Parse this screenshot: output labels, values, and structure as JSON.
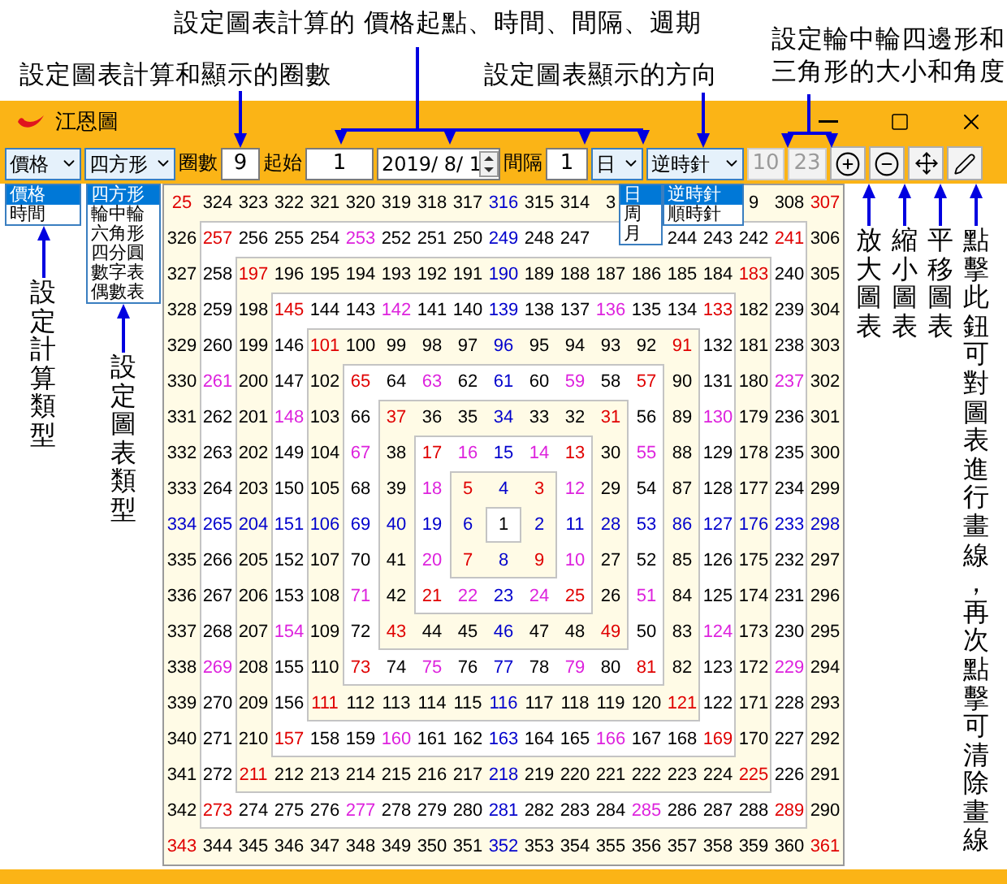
{
  "callouts": [
    {
      "lines": [
        "設定圖表計算的 價格起點、時間、間隔、週期"
      ]
    },
    {
      "lines": [
        "設定圖表計算和顯示的圈數"
      ]
    },
    {
      "lines": [
        "設定圖表顯示的方向"
      ]
    },
    {
      "lines": [
        "設定輪中輪四邊形和",
        "三角形的大小和角度"
      ]
    }
  ],
  "window": {
    "title": "江恩圖"
  },
  "toolbar": {
    "calc_type": {
      "value": "價格",
      "options": [
        {
          "label": "價格",
          "selected": true
        },
        {
          "label": "時間",
          "selected": false
        }
      ]
    },
    "chart_type": {
      "value": "四方形",
      "options": [
        {
          "label": "四方形",
          "selected": true
        },
        {
          "label": "輪中輪",
          "selected": false
        },
        {
          "label": "六角形",
          "selected": false
        },
        {
          "label": "四分圓",
          "selected": false
        },
        {
          "label": "數字表",
          "selected": false
        },
        {
          "label": "偶數表",
          "selected": false
        }
      ]
    },
    "rings_label": "圈數",
    "rings": "9",
    "start_label": "起始",
    "start": "1",
    "date": "2019/ 8/ 1",
    "interval_label": "間隔",
    "interval": "1",
    "period": {
      "value": "日",
      "options": [
        {
          "label": "日",
          "selected": true
        },
        {
          "label": "周",
          "selected": false
        },
        {
          "label": "月",
          "selected": false
        }
      ]
    },
    "direction": {
      "value": "逆時針",
      "options": [
        {
          "label": "逆時針",
          "selected": true
        },
        {
          "label": "順時針",
          "selected": false
        }
      ]
    },
    "size": {
      "value": "10",
      "disabled": true
    },
    "angle": {
      "value": "23",
      "disabled": true
    }
  },
  "side_notes_left": [
    "設定計算類型",
    "設定圖表類型"
  ],
  "side_notes_right": [
    "放大圖表",
    "縮小圖表",
    "平移圖表",
    "點擊此鈕可對圖表進行畫線，再次點擊可清除畫線"
  ],
  "grid": {
    "rows": [
      [
        {
          "text": "25",
          "color": "#e00000"
        },
        {
          "text": "324"
        },
        {
          "text": "323"
        },
        {
          "text": "322"
        },
        {
          "text": "321"
        },
        {
          "text": "320"
        },
        {
          "text": "319"
        },
        {
          "text": "318"
        },
        {
          "text": "317"
        },
        {
          "text": "316",
          "color": "#0000cc"
        },
        {
          "text": "315"
        },
        {
          "text": "314"
        },
        {
          "text": "3"
        },
        null,
        null,
        null,
        {
          "text": "9"
        },
        {
          "text": "308"
        },
        {
          "text": "307",
          "color": "#e00000"
        }
      ],
      [
        {
          "text": "326"
        },
        {
          "text": "257",
          "color": "#e00000"
        },
        {
          "text": "256"
        },
        {
          "text": "255"
        },
        {
          "text": "254"
        },
        {
          "text": "253",
          "color": "#dd22dd"
        },
        {
          "text": "252"
        },
        {
          "text": "251"
        },
        {
          "text": "250"
        },
        {
          "text": "249",
          "color": "#0000cc"
        },
        {
          "text": "248"
        },
        {
          "text": "247"
        },
        null,
        null,
        {
          "text": "244"
        },
        {
          "text": "243"
        },
        {
          "text": "242"
        },
        {
          "text": "241",
          "color": "#e00000"
        },
        {
          "text": "306"
        }
      ],
      [
        {
          "text": "327"
        },
        {
          "text": "258"
        },
        {
          "text": "197",
          "color": "#e00000"
        },
        {
          "text": "196"
        },
        {
          "text": "195"
        },
        {
          "text": "194"
        },
        {
          "text": "193"
        },
        {
          "text": "192"
        },
        {
          "text": "191"
        },
        {
          "text": "190",
          "color": "#0000cc"
        },
        {
          "text": "189"
        },
        {
          "text": "188"
        },
        {
          "text": "187"
        },
        {
          "text": "186"
        },
        {
          "text": "185"
        },
        {
          "text": "184"
        },
        {
          "text": "183",
          "color": "#e00000"
        },
        {
          "text": "240"
        },
        {
          "text": "305"
        }
      ],
      [
        {
          "text": "328"
        },
        {
          "text": "259"
        },
        {
          "text": "198"
        },
        {
          "text": "145",
          "color": "#e00000"
        },
        {
          "text": "144"
        },
        {
          "text": "143"
        },
        {
          "text": "142",
          "color": "#dd22dd"
        },
        {
          "text": "141"
        },
        {
          "text": "140"
        },
        {
          "text": "139",
          "color": "#0000cc"
        },
        {
          "text": "138"
        },
        {
          "text": "137"
        },
        {
          "text": "136",
          "color": "#dd22dd"
        },
        {
          "text": "135"
        },
        {
          "text": "134"
        },
        {
          "text": "133",
          "color": "#e00000"
        },
        {
          "text": "182"
        },
        {
          "text": "239"
        },
        {
          "text": "304"
        }
      ],
      [
        {
          "text": "329"
        },
        {
          "text": "260"
        },
        {
          "text": "199"
        },
        {
          "text": "146"
        },
        {
          "text": "101",
          "color": "#e00000"
        },
        {
          "text": "100"
        },
        {
          "text": "99"
        },
        {
          "text": "98"
        },
        {
          "text": "97"
        },
        {
          "text": "96",
          "color": "#0000cc"
        },
        {
          "text": "95"
        },
        {
          "text": "94"
        },
        {
          "text": "93"
        },
        {
          "text": "92"
        },
        {
          "text": "91",
          "color": "#e00000"
        },
        {
          "text": "132"
        },
        {
          "text": "181"
        },
        {
          "text": "238"
        },
        {
          "text": "303"
        }
      ],
      [
        {
          "text": "330"
        },
        {
          "text": "261",
          "color": "#dd22dd"
        },
        {
          "text": "200"
        },
        {
          "text": "147"
        },
        {
          "text": "102"
        },
        {
          "text": "65",
          "color": "#e00000"
        },
        {
          "text": "64"
        },
        {
          "text": "63",
          "color": "#dd22dd"
        },
        {
          "text": "62"
        },
        {
          "text": "61",
          "color": "#0000cc"
        },
        {
          "text": "60"
        },
        {
          "text": "59",
          "color": "#dd22dd"
        },
        {
          "text": "58"
        },
        {
          "text": "57",
          "color": "#e00000"
        },
        {
          "text": "90"
        },
        {
          "text": "131"
        },
        {
          "text": "180"
        },
        {
          "text": "237",
          "color": "#dd22dd"
        },
        {
          "text": "302"
        }
      ],
      [
        {
          "text": "331"
        },
        {
          "text": "262"
        },
        {
          "text": "201"
        },
        {
          "text": "148",
          "color": "#dd22dd"
        },
        {
          "text": "103"
        },
        {
          "text": "66"
        },
        {
          "text": "37",
          "color": "#e00000"
        },
        {
          "text": "36"
        },
        {
          "text": "35"
        },
        {
          "text": "34",
          "color": "#0000cc"
        },
        {
          "text": "33"
        },
        {
          "text": "32"
        },
        {
          "text": "31",
          "color": "#e00000"
        },
        {
          "text": "56"
        },
        {
          "text": "89"
        },
        {
          "text": "130",
          "color": "#dd22dd"
        },
        {
          "text": "179"
        },
        {
          "text": "236"
        },
        {
          "text": "301"
        }
      ],
      [
        {
          "text": "332"
        },
        {
          "text": "263"
        },
        {
          "text": "202"
        },
        {
          "text": "149"
        },
        {
          "text": "104"
        },
        {
          "text": "67",
          "color": "#dd22dd"
        },
        {
          "text": "38"
        },
        {
          "text": "17",
          "color": "#e00000"
        },
        {
          "text": "16",
          "color": "#dd22dd"
        },
        {
          "text": "15",
          "color": "#0000cc"
        },
        {
          "text": "14",
          "color": "#dd22dd"
        },
        {
          "text": "13",
          "color": "#e00000"
        },
        {
          "text": "30"
        },
        {
          "text": "55",
          "color": "#dd22dd"
        },
        {
          "text": "88"
        },
        {
          "text": "129"
        },
        {
          "text": "178"
        },
        {
          "text": "235"
        },
        {
          "text": "300"
        }
      ],
      [
        {
          "text": "333"
        },
        {
          "text": "264"
        },
        {
          "text": "203"
        },
        {
          "text": "150"
        },
        {
          "text": "105"
        },
        {
          "text": "68"
        },
        {
          "text": "39"
        },
        {
          "text": "18",
          "color": "#dd22dd"
        },
        {
          "text": "5",
          "color": "#e00000"
        },
        {
          "text": "4",
          "color": "#0000cc"
        },
        {
          "text": "3",
          "color": "#e00000"
        },
        {
          "text": "12",
          "color": "#dd22dd"
        },
        {
          "text": "29"
        },
        {
          "text": "54"
        },
        {
          "text": "87"
        },
        {
          "text": "128"
        },
        {
          "text": "177"
        },
        {
          "text": "234"
        },
        {
          "text": "299"
        }
      ],
      [
        {
          "text": "334",
          "color": "#0000cc"
        },
        {
          "text": "265",
          "color": "#0000cc"
        },
        {
          "text": "204",
          "color": "#0000cc"
        },
        {
          "text": "151",
          "color": "#0000cc"
        },
        {
          "text": "106",
          "color": "#0000cc"
        },
        {
          "text": "69",
          "color": "#0000cc"
        },
        {
          "text": "40",
          "color": "#0000cc"
        },
        {
          "text": "19",
          "color": "#0000cc"
        },
        {
          "text": "6",
          "color": "#0000cc"
        },
        {
          "text": "1"
        },
        {
          "text": "2",
          "color": "#0000cc"
        },
        {
          "text": "11",
          "color": "#0000cc"
        },
        {
          "text": "28",
          "color": "#0000cc"
        },
        {
          "text": "53",
          "color": "#0000cc"
        },
        {
          "text": "86",
          "color": "#0000cc"
        },
        {
          "text": "127",
          "color": "#0000cc"
        },
        {
          "text": "176",
          "color": "#0000cc"
        },
        {
          "text": "233",
          "color": "#0000cc"
        },
        {
          "text": "298",
          "color": "#0000cc"
        }
      ],
      [
        {
          "text": "335"
        },
        {
          "text": "266"
        },
        {
          "text": "205"
        },
        {
          "text": "152"
        },
        {
          "text": "107"
        },
        {
          "text": "70"
        },
        {
          "text": "41"
        },
        {
          "text": "20",
          "color": "#dd22dd"
        },
        {
          "text": "7",
          "color": "#e00000"
        },
        {
          "text": "8",
          "color": "#0000cc"
        },
        {
          "text": "9",
          "color": "#e00000"
        },
        {
          "text": "10",
          "color": "#dd22dd"
        },
        {
          "text": "27"
        },
        {
          "text": "52"
        },
        {
          "text": "85"
        },
        {
          "text": "126"
        },
        {
          "text": "175"
        },
        {
          "text": "232"
        },
        {
          "text": "297"
        }
      ],
      [
        {
          "text": "336"
        },
        {
          "text": "267"
        },
        {
          "text": "206"
        },
        {
          "text": "153"
        },
        {
          "text": "108"
        },
        {
          "text": "71",
          "color": "#dd22dd"
        },
        {
          "text": "42"
        },
        {
          "text": "21",
          "color": "#e00000"
        },
        {
          "text": "22",
          "color": "#dd22dd"
        },
        {
          "text": "23",
          "color": "#0000cc"
        },
        {
          "text": "24",
          "color": "#dd22dd"
        },
        {
          "text": "25",
          "color": "#e00000"
        },
        {
          "text": "26"
        },
        {
          "text": "51",
          "color": "#dd22dd"
        },
        {
          "text": "84"
        },
        {
          "text": "125"
        },
        {
          "text": "174"
        },
        {
          "text": "231"
        },
        {
          "text": "296"
        }
      ],
      [
        {
          "text": "337"
        },
        {
          "text": "268"
        },
        {
          "text": "207"
        },
        {
          "text": "154",
          "color": "#dd22dd"
        },
        {
          "text": "109"
        },
        {
          "text": "72"
        },
        {
          "text": "43",
          "color": "#e00000"
        },
        {
          "text": "44"
        },
        {
          "text": "45"
        },
        {
          "text": "46",
          "color": "#0000cc"
        },
        {
          "text": "47"
        },
        {
          "text": "48"
        },
        {
          "text": "49",
          "color": "#e00000"
        },
        {
          "text": "50"
        },
        {
          "text": "83"
        },
        {
          "text": "124",
          "color": "#dd22dd"
        },
        {
          "text": "173"
        },
        {
          "text": "230"
        },
        {
          "text": "295"
        }
      ],
      [
        {
          "text": "338"
        },
        {
          "text": "269",
          "color": "#dd22dd"
        },
        {
          "text": "208"
        },
        {
          "text": "155"
        },
        {
          "text": "110"
        },
        {
          "text": "73",
          "color": "#e00000"
        },
        {
          "text": "74"
        },
        {
          "text": "75",
          "color": "#dd22dd"
        },
        {
          "text": "76"
        },
        {
          "text": "77",
          "color": "#0000cc"
        },
        {
          "text": "78"
        },
        {
          "text": "79",
          "color": "#dd22dd"
        },
        {
          "text": "80"
        },
        {
          "text": "81",
          "color": "#e00000"
        },
        {
          "text": "82"
        },
        {
          "text": "123"
        },
        {
          "text": "172"
        },
        {
          "text": "229",
          "color": "#dd22dd"
        },
        {
          "text": "294"
        }
      ],
      [
        {
          "text": "339"
        },
        {
          "text": "270"
        },
        {
          "text": "209"
        },
        {
          "text": "156"
        },
        {
          "text": "111",
          "color": "#e00000"
        },
        {
          "text": "112"
        },
        {
          "text": "113"
        },
        {
          "text": "114"
        },
        {
          "text": "115"
        },
        {
          "text": "116",
          "color": "#0000cc"
        },
        {
          "text": "117"
        },
        {
          "text": "118"
        },
        {
          "text": "119"
        },
        {
          "text": "120"
        },
        {
          "text": "121",
          "color": "#e00000"
        },
        {
          "text": "122"
        },
        {
          "text": "171"
        },
        {
          "text": "228"
        },
        {
          "text": "293"
        }
      ],
      [
        {
          "text": "340"
        },
        {
          "text": "271"
        },
        {
          "text": "210"
        },
        {
          "text": "157",
          "color": "#e00000"
        },
        {
          "text": "158"
        },
        {
          "text": "159"
        },
        {
          "text": "160",
          "color": "#dd22dd"
        },
        {
          "text": "161"
        },
        {
          "text": "162"
        },
        {
          "text": "163",
          "color": "#0000cc"
        },
        {
          "text": "164"
        },
        {
          "text": "165"
        },
        {
          "text": "166",
          "color": "#dd22dd"
        },
        {
          "text": "167"
        },
        {
          "text": "168"
        },
        {
          "text": "169",
          "color": "#e00000"
        },
        {
          "text": "170"
        },
        {
          "text": "227"
        },
        {
          "text": "292"
        }
      ],
      [
        {
          "text": "341"
        },
        {
          "text": "272"
        },
        {
          "text": "211",
          "color": "#e00000"
        },
        {
          "text": "212"
        },
        {
          "text": "213"
        },
        {
          "text": "214"
        },
        {
          "text": "215"
        },
        {
          "text": "216"
        },
        {
          "text": "217"
        },
        {
          "text": "218",
          "color": "#0000cc"
        },
        {
          "text": "219"
        },
        {
          "text": "220"
        },
        {
          "text": "221"
        },
        {
          "text": "222"
        },
        {
          "text": "223"
        },
        {
          "text": "224"
        },
        {
          "text": "225",
          "color": "#e00000"
        },
        {
          "text": "226"
        },
        {
          "text": "291"
        }
      ],
      [
        {
          "text": "342"
        },
        {
          "text": "273",
          "color": "#e00000"
        },
        {
          "text": "274"
        },
        {
          "text": "275"
        },
        {
          "text": "276"
        },
        {
          "text": "277",
          "color": "#dd22dd"
        },
        {
          "text": "278"
        },
        {
          "text": "279"
        },
        {
          "text": "280"
        },
        {
          "text": "281",
          "color": "#0000cc"
        },
        {
          "text": "282"
        },
        {
          "text": "283"
        },
        {
          "text": "284"
        },
        {
          "text": "285",
          "color": "#dd22dd"
        },
        {
          "text": "286"
        },
        {
          "text": "287"
        },
        {
          "text": "288"
        },
        {
          "text": "289",
          "color": "#e00000"
        },
        {
          "text": "290"
        }
      ],
      [
        {
          "text": "343",
          "color": "#e00000"
        },
        {
          "text": "344"
        },
        {
          "text": "345"
        },
        {
          "text": "346"
        },
        {
          "text": "347"
        },
        {
          "text": "348"
        },
        {
          "text": "349"
        },
        {
          "text": "350"
        },
        {
          "text": "351"
        },
        {
          "text": "352",
          "color": "#0000cc"
        },
        {
          "text": "353"
        },
        {
          "text": "354"
        },
        {
          "text": "355"
        },
        {
          "text": "356"
        },
        {
          "text": "357"
        },
        {
          "text": "358"
        },
        {
          "text": "359"
        },
        {
          "text": "360"
        },
        {
          "text": "361",
          "color": "#e00000"
        }
      ]
    ]
  }
}
